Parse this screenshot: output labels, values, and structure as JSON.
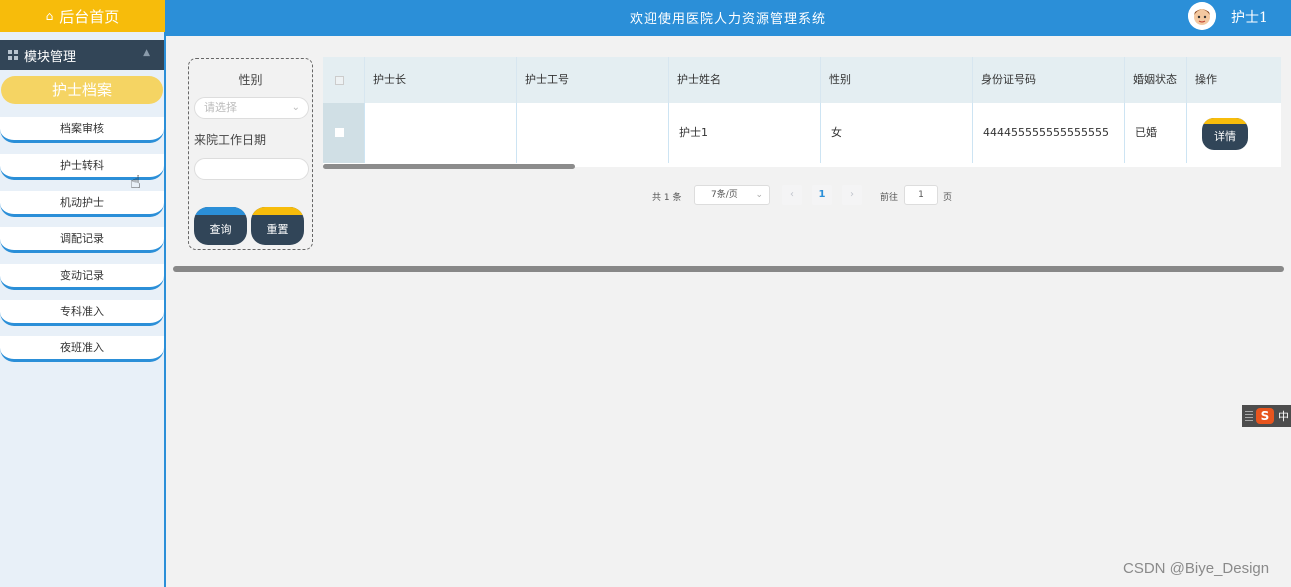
{
  "header": {
    "home_label": "后台首页",
    "site_title": "欢迎使用医院人力资源管理系统",
    "user_name": "护士1",
    "home_icon": "home-icon",
    "accent_color": "#2b8fd8",
    "home_color": "#f7bc0b"
  },
  "sidebar": {
    "section_label": "模块管理",
    "section_icon": "grid-icon",
    "active_item": "护士档案",
    "items": [
      {
        "label": "档案审核"
      },
      {
        "label": "护士转科"
      },
      {
        "label": "机动护士"
      },
      {
        "label": "调配记录"
      },
      {
        "label": "变动记录"
      },
      {
        "label": "专科准入"
      },
      {
        "label": "夜班准入"
      }
    ]
  },
  "search": {
    "gender_label": "性别",
    "gender_placeholder": "请选择",
    "date_label": "来院工作日期",
    "date_value": "",
    "query_label": "查询",
    "reset_label": "重置"
  },
  "table": {
    "columns": [
      "护士长",
      "护士工号",
      "护士姓名",
      "性别",
      "身份证号码",
      "婚姻状态",
      "操作"
    ],
    "rows": [
      {
        "head_nurse": "",
        "nurse_id": "",
        "nurse_name": "护士1",
        "gender": "女",
        "id_number": "444455555555555555",
        "marital_status": "已婚",
        "action_label": "详情"
      }
    ]
  },
  "pagination": {
    "total_text": "共 1 条",
    "page_size": "7条/页",
    "current_page": "1",
    "goto_label": "前往",
    "goto_value": "1",
    "page_suffix": "页"
  },
  "ime": {
    "logo": "S",
    "mode": "中"
  },
  "watermark": "CSDN @Biye_Design"
}
